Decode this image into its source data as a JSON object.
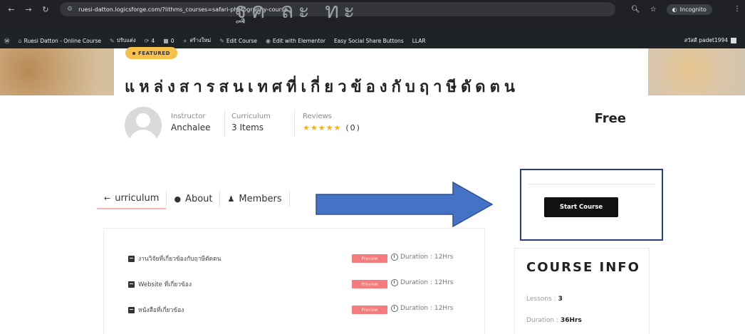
{
  "browser": {
    "url": "ruesi-datton.logicsforge.com/?lithms_courses=safari-photography-course",
    "incognito_label": "Incognito",
    "title_fragment": "ฐค  ละ ทะ"
  },
  "wp_admin_bar": {
    "site_name": "Ruesi Datton - Online Course",
    "customize": "ปรับแต่ง",
    "updates": "4",
    "comments": "0",
    "new": "สร้างใหม่",
    "edit_course": "Edit Course",
    "edit_elementor": "Edit with Elementor",
    "share_buttons": "Easy Social Share Buttons",
    "llar": "LLAR",
    "user": "สวัสดี padet1994"
  },
  "course": {
    "badge": "FEATURED",
    "title": "แหล่งสารสนเทศที่เกี่ยวข้องกับฤาษีดัดตน",
    "instructor_label": "Instructor",
    "instructor_name": "Anchalee",
    "curriculum_label": "Curriculum",
    "curriculum_value": "3 Items",
    "reviews_label": "Reviews",
    "stars": "★★★★★",
    "reviews_count": "(0)",
    "price": "Free"
  },
  "tabs": [
    {
      "label": "urriculum",
      "icon": "←"
    },
    {
      "label": "About",
      "icon": "●"
    },
    {
      "label": "Members",
      "icon": "♟"
    }
  ],
  "lessons": [
    {
      "title": "งานวิจัยที่เกี่ยวข้องกับฤาษีดัดตน",
      "preview": "Preview",
      "duration": "Duration : 12Hrs"
    },
    {
      "title": "Website ที่เกี่ยวข้อง",
      "preview": "Preview",
      "duration": "Duration : 12Hrs"
    },
    {
      "title": "หนังสือที่เกี่ยวข้อง",
      "preview": "Preview",
      "duration": "Duration : 12Hrs"
    }
  ],
  "sidebar": {
    "start_button": "Start Course",
    "course_info_title": "COURSE INFO",
    "lessons_label": "Lessons :",
    "lessons_value": "3",
    "duration_label": "Duration :",
    "duration_value": "36Hrs"
  },
  "colors": {
    "accent_arrow": "#4472c4",
    "highlight_box": "#2a3e7d",
    "badge": "#f6c04a",
    "preview_tag": "#f47c7c"
  }
}
